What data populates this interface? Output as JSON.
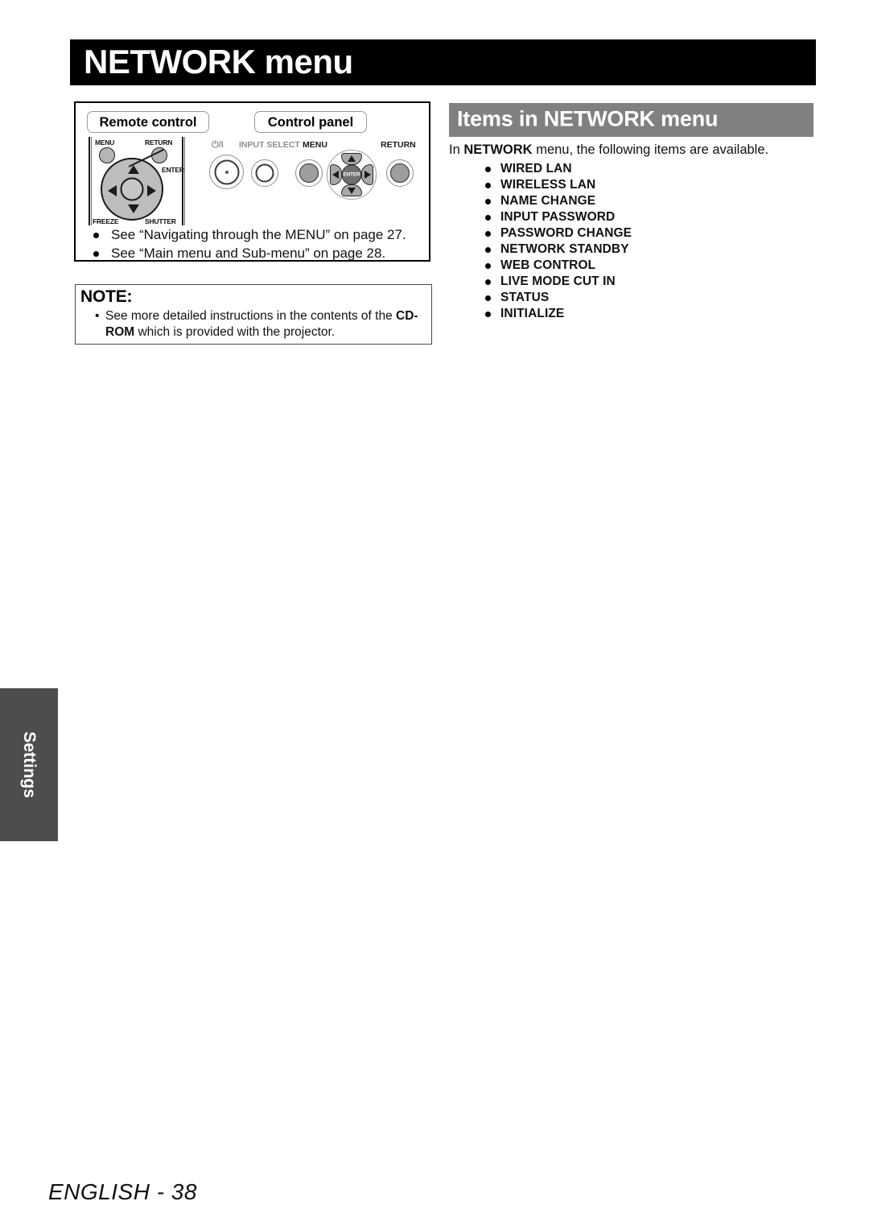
{
  "page": {
    "title": "NETWORK menu",
    "footer": "ENGLISH - 38",
    "side_tab": "Settings",
    "colors": {
      "title_bar_bg": "#000000",
      "section_header_bg": "#808080",
      "side_tab_bg": "#4d4d4d",
      "text": "#111111"
    }
  },
  "reference_box": {
    "remote_control_label": "Remote control",
    "control_panel_label": "Control panel",
    "remote_control": {
      "menu_label": "MENU",
      "return_label": "RETURN",
      "enter_label": "ENTER",
      "freeze_label": "FREEZE",
      "shutter_label": "SHUTTER"
    },
    "control_panel": {
      "power_label": "⏻/I",
      "input_select_label": "INPUT SELECT",
      "menu_label": "MENU",
      "return_label": "RETURN",
      "enter_label": "ENTER"
    },
    "see_also": [
      "See “Navigating through the MENU” on page 27.",
      "See “Main menu and Sub-menu” on page 28."
    ]
  },
  "note": {
    "heading": "NOTE:",
    "bullet": "•",
    "text_before": "See more detailed instructions in the contents of the ",
    "text_bold": "CD-ROM",
    "text_after": " which is provided with the projector."
  },
  "items_section": {
    "header": "Items in NETWORK menu",
    "intro_before": "In ",
    "intro_bold": "NETWORK",
    "intro_after": " menu, the following items are available.",
    "items": [
      "WIRED LAN",
      "WIRELESS LAN",
      "NAME CHANGE",
      "INPUT PASSWORD",
      "PASSWORD CHANGE",
      "NETWORK STANDBY",
      "WEB CONTROL",
      "LIVE MODE CUT IN",
      "STATUS",
      "INITIALIZE"
    ]
  }
}
